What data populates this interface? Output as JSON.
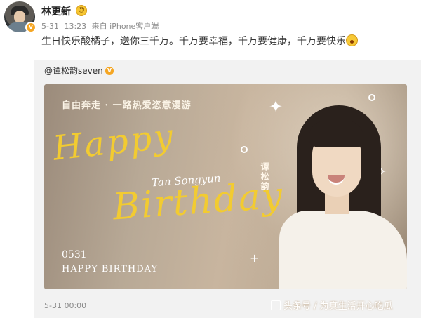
{
  "post": {
    "author": {
      "name": "林更新",
      "verified_badge": "V"
    },
    "meta": {
      "date": "5-31",
      "time": "13:23",
      "source": "来自 iPhone客户端"
    },
    "text": "生日快乐酸橘子，送你三千万。千万要幸福，千万要健康，千万要快乐"
  },
  "repost": {
    "author": "@谭松韵seven",
    "verified_badge": "V",
    "image": {
      "tagline": "自由奔走 · 一路热爱恣意漫游",
      "script_happy": "Happy",
      "script_birthday": "Birthday",
      "script_name": "Tan Songyun",
      "name_vertical": "谭松韵",
      "date": "0531",
      "happy_birthday": "HAPPY BIRTHDAY"
    },
    "timestamp": "5-31 00:00"
  },
  "watermark": "头条号 / 为真生活开心吃瓜",
  "colors": {
    "accent_gold": "#f2cb31",
    "badge_orange": "#f5a623",
    "meta_gray": "#8a8a8a"
  }
}
